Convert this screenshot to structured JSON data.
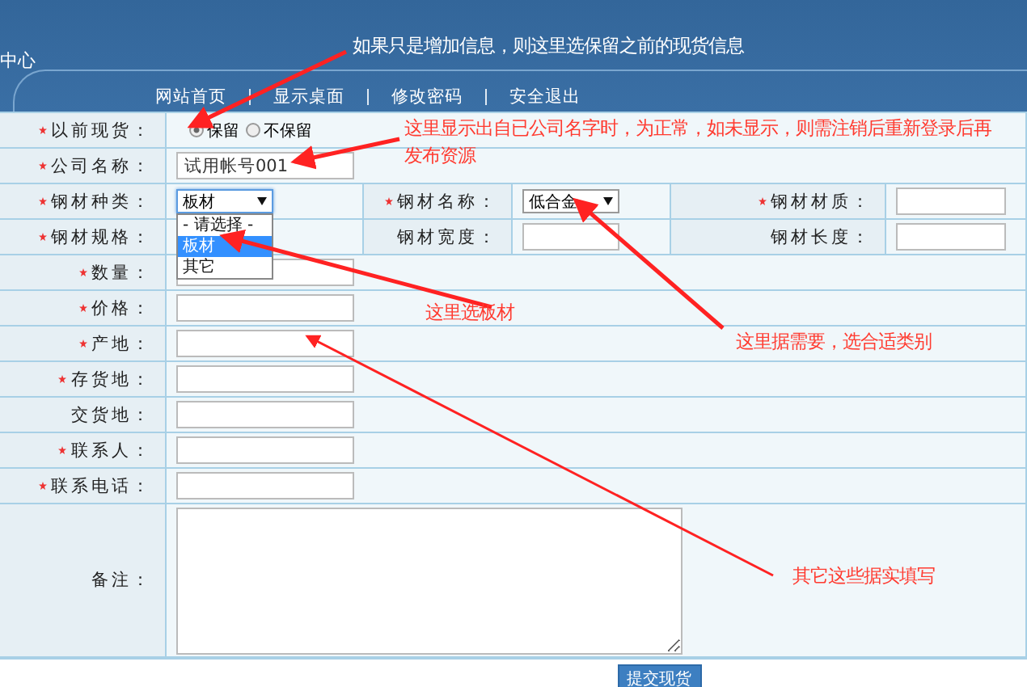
{
  "header": {
    "title_fragment": "中心",
    "nav": [
      "网站首页",
      "显示桌面",
      "修改密码",
      "安全退出"
    ]
  },
  "rows": [
    {
      "kind": "radio",
      "cells": [
        {
          "label": "以前现货：",
          "required": true,
          "options": [
            {
              "label": "保留",
              "selected": true
            },
            {
              "label": "不保留",
              "selected": false
            }
          ]
        }
      ]
    },
    {
      "kind": "text",
      "cells": [
        {
          "label": "公司名称：",
          "required": true,
          "value": "试用帐号001"
        }
      ]
    },
    {
      "kind": "triple",
      "cells": [
        {
          "kind": "select",
          "label": "钢材种类：",
          "required": true,
          "value": "板材",
          "expanded": true,
          "options": [
            {
              "label": "- 请选择 -",
              "selected": false
            },
            {
              "label": "板材",
              "selected": true
            },
            {
              "label": "其它",
              "selected": false
            }
          ]
        },
        {
          "kind": "select",
          "label": "钢材名称：",
          "required": true,
          "value": "低合金",
          "expanded": false
        },
        {
          "kind": "text",
          "label": "钢材材质：",
          "required": true
        }
      ]
    },
    {
      "kind": "triple",
      "cells": [
        {
          "kind": "text",
          "label": "钢材规格：",
          "required": true
        },
        {
          "kind": "text",
          "label": "钢材宽度：",
          "required": false
        },
        {
          "kind": "text",
          "label": "钢材长度：",
          "required": false
        }
      ]
    },
    {
      "kind": "text",
      "cells": [
        {
          "label": "数量：",
          "required": true
        }
      ]
    },
    {
      "kind": "text",
      "cells": [
        {
          "label": "价格：",
          "required": true
        }
      ]
    },
    {
      "kind": "text",
      "cells": [
        {
          "label": "产地：",
          "required": true
        }
      ]
    },
    {
      "kind": "text",
      "cells": [
        {
          "label": "存货地：",
          "required": true
        }
      ]
    },
    {
      "kind": "text",
      "cells": [
        {
          "label": "交货地：",
          "required": false
        }
      ]
    },
    {
      "kind": "text",
      "cells": [
        {
          "label": "联系人：",
          "required": true
        }
      ]
    },
    {
      "kind": "text",
      "cells": [
        {
          "label": "联系电话：",
          "required": true
        }
      ]
    },
    {
      "kind": "textarea",
      "cells": [
        {
          "label": "备注：",
          "required": false
        }
      ]
    }
  ],
  "submit": "提交现货",
  "annotations": [
    {
      "lines": [
        "如果只是增加信息，则这里选保留之前的现货信息"
      ],
      "color": "#ffffff"
    },
    {
      "lines": [
        "这里显示出自已公司名字时，为正常，如未显示，则需注销后重新登录后再",
        "发布资源"
      ],
      "color": "#ff3b30"
    },
    {
      "lines": [
        "这里选板材"
      ],
      "color": "#ff3b30"
    },
    {
      "lines": [
        "这里据需要，选合适类别"
      ],
      "color": "#ff3b30"
    },
    {
      "lines": [
        "其它这些据实填写"
      ],
      "color": "#ff3b30"
    }
  ]
}
